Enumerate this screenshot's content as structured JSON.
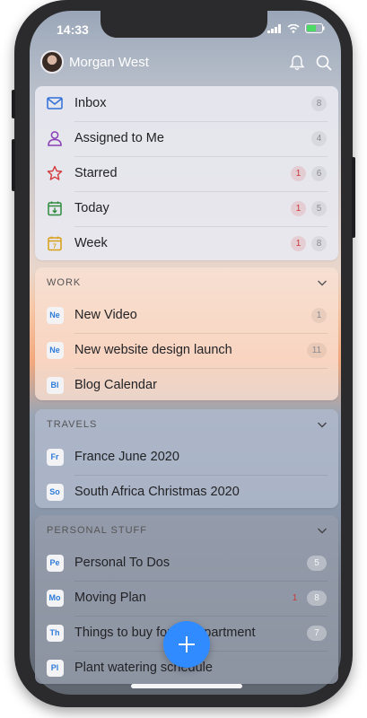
{
  "status_bar": {
    "time": "14:33"
  },
  "header": {
    "user_name": "Morgan West",
    "icons": [
      "bell-icon",
      "search-icon"
    ]
  },
  "smart_lists": [
    {
      "label": "Inbox",
      "icon": "inbox-icon",
      "count": "8"
    },
    {
      "label": "Assigned to Me",
      "icon": "person-icon",
      "count": "4"
    },
    {
      "label": "Starred",
      "icon": "star-icon",
      "due": "1",
      "count": "6"
    },
    {
      "label": "Today",
      "icon": "today-calendar-icon",
      "due": "1",
      "count": "5"
    },
    {
      "label": "Week",
      "icon": "week-calendar-icon",
      "due": "1",
      "count": "8"
    }
  ],
  "sections": {
    "work": {
      "title": "WORK",
      "items": [
        {
          "abbr": "Ne",
          "label": "New Video",
          "count": "1"
        },
        {
          "abbr": "Ne",
          "label": "New website design launch",
          "count": "11"
        },
        {
          "abbr": "Bl",
          "label": "Blog Calendar"
        }
      ]
    },
    "travels": {
      "title": "TRAVELS",
      "items": [
        {
          "abbr": "Fr",
          "label": "France June 2020"
        },
        {
          "abbr": "So",
          "label": "South Africa Christmas 2020"
        }
      ]
    },
    "personal": {
      "title": "PERSONAL STUFF",
      "items": [
        {
          "abbr": "Pe",
          "label": "Personal To Dos",
          "count": "5"
        },
        {
          "abbr": "Mo",
          "label": "Moving Plan",
          "due": "1",
          "count": "8"
        },
        {
          "abbr": "Th",
          "label": "Things to buy for the apartment",
          "count": "7"
        },
        {
          "abbr": "Pl",
          "label": "Plant watering schedule"
        }
      ]
    }
  },
  "colors": {
    "accent": "#2f8bff",
    "due": "#c83a3a"
  }
}
